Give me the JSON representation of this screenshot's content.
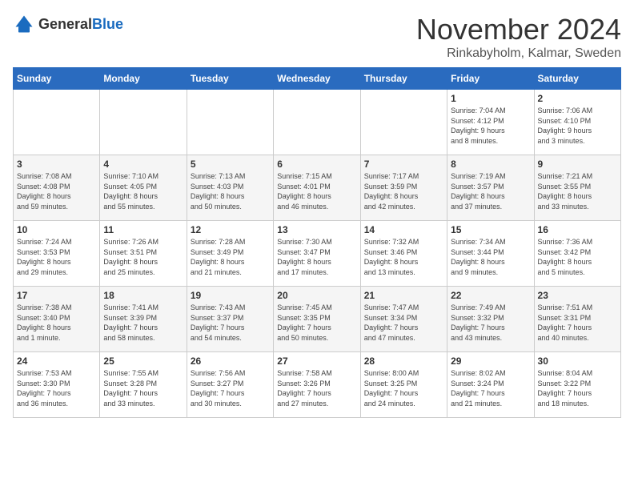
{
  "header": {
    "logo": {
      "general": "General",
      "blue": "Blue"
    },
    "title": "November 2024",
    "location": "Rinkabyholm, Kalmar, Sweden"
  },
  "weekdays": [
    "Sunday",
    "Monday",
    "Tuesday",
    "Wednesday",
    "Thursday",
    "Friday",
    "Saturday"
  ],
  "weeks": [
    [
      {
        "day": "",
        "detail": ""
      },
      {
        "day": "",
        "detail": ""
      },
      {
        "day": "",
        "detail": ""
      },
      {
        "day": "",
        "detail": ""
      },
      {
        "day": "",
        "detail": ""
      },
      {
        "day": "1",
        "detail": "Sunrise: 7:04 AM\nSunset: 4:12 PM\nDaylight: 9 hours\nand 8 minutes."
      },
      {
        "day": "2",
        "detail": "Sunrise: 7:06 AM\nSunset: 4:10 PM\nDaylight: 9 hours\nand 3 minutes."
      }
    ],
    [
      {
        "day": "3",
        "detail": "Sunrise: 7:08 AM\nSunset: 4:08 PM\nDaylight: 8 hours\nand 59 minutes."
      },
      {
        "day": "4",
        "detail": "Sunrise: 7:10 AM\nSunset: 4:05 PM\nDaylight: 8 hours\nand 55 minutes."
      },
      {
        "day": "5",
        "detail": "Sunrise: 7:13 AM\nSunset: 4:03 PM\nDaylight: 8 hours\nand 50 minutes."
      },
      {
        "day": "6",
        "detail": "Sunrise: 7:15 AM\nSunset: 4:01 PM\nDaylight: 8 hours\nand 46 minutes."
      },
      {
        "day": "7",
        "detail": "Sunrise: 7:17 AM\nSunset: 3:59 PM\nDaylight: 8 hours\nand 42 minutes."
      },
      {
        "day": "8",
        "detail": "Sunrise: 7:19 AM\nSunset: 3:57 PM\nDaylight: 8 hours\nand 37 minutes."
      },
      {
        "day": "9",
        "detail": "Sunrise: 7:21 AM\nSunset: 3:55 PM\nDaylight: 8 hours\nand 33 minutes."
      }
    ],
    [
      {
        "day": "10",
        "detail": "Sunrise: 7:24 AM\nSunset: 3:53 PM\nDaylight: 8 hours\nand 29 minutes."
      },
      {
        "day": "11",
        "detail": "Sunrise: 7:26 AM\nSunset: 3:51 PM\nDaylight: 8 hours\nand 25 minutes."
      },
      {
        "day": "12",
        "detail": "Sunrise: 7:28 AM\nSunset: 3:49 PM\nDaylight: 8 hours\nand 21 minutes."
      },
      {
        "day": "13",
        "detail": "Sunrise: 7:30 AM\nSunset: 3:47 PM\nDaylight: 8 hours\nand 17 minutes."
      },
      {
        "day": "14",
        "detail": "Sunrise: 7:32 AM\nSunset: 3:46 PM\nDaylight: 8 hours\nand 13 minutes."
      },
      {
        "day": "15",
        "detail": "Sunrise: 7:34 AM\nSunset: 3:44 PM\nDaylight: 8 hours\nand 9 minutes."
      },
      {
        "day": "16",
        "detail": "Sunrise: 7:36 AM\nSunset: 3:42 PM\nDaylight: 8 hours\nand 5 minutes."
      }
    ],
    [
      {
        "day": "17",
        "detail": "Sunrise: 7:38 AM\nSunset: 3:40 PM\nDaylight: 8 hours\nand 1 minute."
      },
      {
        "day": "18",
        "detail": "Sunrise: 7:41 AM\nSunset: 3:39 PM\nDaylight: 7 hours\nand 58 minutes."
      },
      {
        "day": "19",
        "detail": "Sunrise: 7:43 AM\nSunset: 3:37 PM\nDaylight: 7 hours\nand 54 minutes."
      },
      {
        "day": "20",
        "detail": "Sunrise: 7:45 AM\nSunset: 3:35 PM\nDaylight: 7 hours\nand 50 minutes."
      },
      {
        "day": "21",
        "detail": "Sunrise: 7:47 AM\nSunset: 3:34 PM\nDaylight: 7 hours\nand 47 minutes."
      },
      {
        "day": "22",
        "detail": "Sunrise: 7:49 AM\nSunset: 3:32 PM\nDaylight: 7 hours\nand 43 minutes."
      },
      {
        "day": "23",
        "detail": "Sunrise: 7:51 AM\nSunset: 3:31 PM\nDaylight: 7 hours\nand 40 minutes."
      }
    ],
    [
      {
        "day": "24",
        "detail": "Sunrise: 7:53 AM\nSunset: 3:30 PM\nDaylight: 7 hours\nand 36 minutes."
      },
      {
        "day": "25",
        "detail": "Sunrise: 7:55 AM\nSunset: 3:28 PM\nDaylight: 7 hours\nand 33 minutes."
      },
      {
        "day": "26",
        "detail": "Sunrise: 7:56 AM\nSunset: 3:27 PM\nDaylight: 7 hours\nand 30 minutes."
      },
      {
        "day": "27",
        "detail": "Sunrise: 7:58 AM\nSunset: 3:26 PM\nDaylight: 7 hours\nand 27 minutes."
      },
      {
        "day": "28",
        "detail": "Sunrise: 8:00 AM\nSunset: 3:25 PM\nDaylight: 7 hours\nand 24 minutes."
      },
      {
        "day": "29",
        "detail": "Sunrise: 8:02 AM\nSunset: 3:24 PM\nDaylight: 7 hours\nand 21 minutes."
      },
      {
        "day": "30",
        "detail": "Sunrise: 8:04 AM\nSunset: 3:22 PM\nDaylight: 7 hours\nand 18 minutes."
      }
    ]
  ]
}
